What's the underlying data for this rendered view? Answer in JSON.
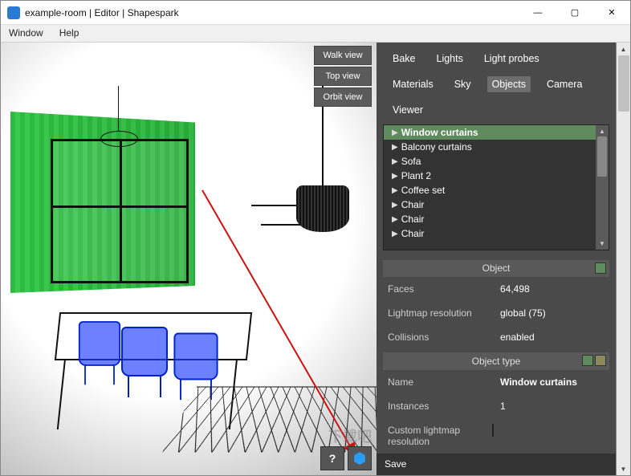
{
  "window": {
    "title": "example-room | Editor | Shapespark",
    "controls": {
      "minimize": "—",
      "maximize": "▢",
      "close": "✕"
    }
  },
  "menubar": [
    "Window",
    "Help"
  ],
  "viewport": {
    "view_buttons": [
      "Walk view",
      "Top view",
      "Orbit view"
    ],
    "bottom_icons": {
      "help": "?",
      "cube": "⬢"
    }
  },
  "panel": {
    "tabs_row1": [
      "Bake",
      "Lights",
      "Light probes",
      "Materials",
      "Sky"
    ],
    "tabs_row2": [
      "Objects",
      "Camera",
      "Viewer"
    ],
    "active_tab": "Objects",
    "tree": [
      {
        "name": "Window curtains",
        "selected": true
      },
      {
        "name": "Balcony curtains"
      },
      {
        "name": "Sofa"
      },
      {
        "name": "Plant 2"
      },
      {
        "name": "Coffee set"
      },
      {
        "name": "Chair"
      },
      {
        "name": "Chair"
      },
      {
        "name": "Chair"
      }
    ],
    "object_section": {
      "header": "Object",
      "rows": {
        "faces": {
          "k": "Faces",
          "v": "64,498"
        },
        "lightmap_resolution": {
          "k": "Lightmap resolution",
          "v": "global (75)"
        },
        "collisions": {
          "k": "Collisions",
          "v": "enabled"
        }
      }
    },
    "object_type_section": {
      "header": "Object type",
      "rows": {
        "name": {
          "k": "Name",
          "v": "Window curtains"
        },
        "instances": {
          "k": "Instances",
          "v": "1"
        },
        "custom_lm": {
          "k": "Custom lightmap resolution"
        }
      }
    },
    "save": "Save"
  },
  "watermark": "下载吧"
}
